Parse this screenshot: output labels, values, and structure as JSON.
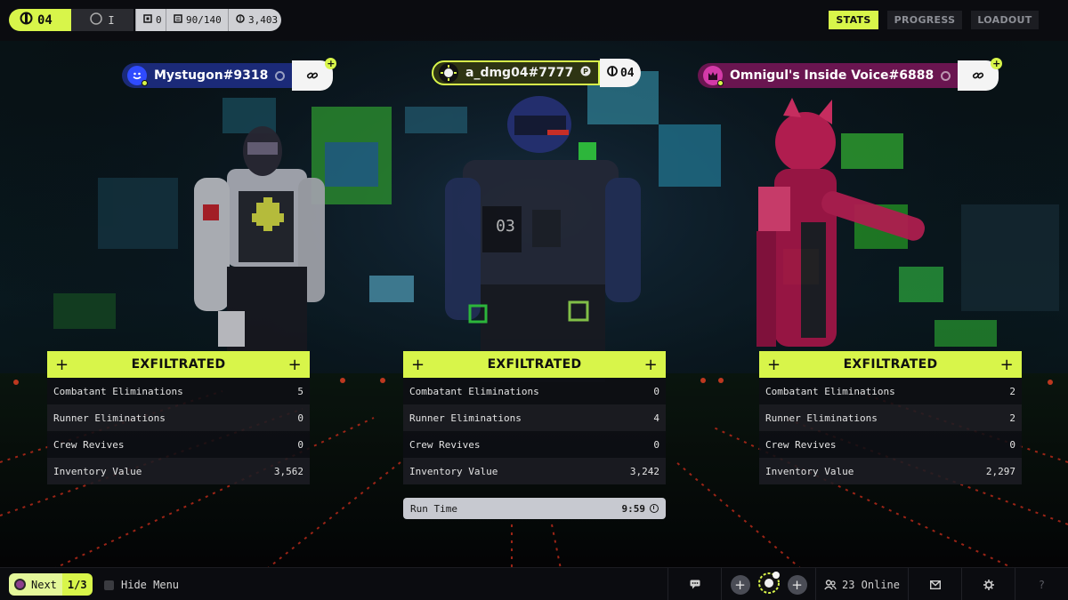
{
  "topbar": {
    "level": "04",
    "rank": "I",
    "stat_a": "0",
    "stat_b": "90/140",
    "stat_c": "3,403",
    "tabs": [
      {
        "label": "STATS",
        "active": true
      },
      {
        "label": "PROGRESS",
        "active": false
      },
      {
        "label": "LOADOUT",
        "active": false
      }
    ]
  },
  "players": [
    {
      "name": "Mystugon#9318",
      "color": "#1b2a78",
      "stats": {
        "status": "EXFILTRATED",
        "rows": [
          {
            "label": "Combatant Eliminations",
            "value": "5"
          },
          {
            "label": "Runner Eliminations",
            "value": "0"
          },
          {
            "label": "Crew Revives",
            "value": "0"
          },
          {
            "label": "Inventory Value",
            "value": "3,562"
          }
        ]
      }
    },
    {
      "name": "a_dmg04#7777",
      "level": "04",
      "color": "#d8f54a",
      "stats": {
        "status": "EXFILTRATED",
        "rows": [
          {
            "label": "Combatant Eliminations",
            "value": "0"
          },
          {
            "label": "Runner Eliminations",
            "value": "4"
          },
          {
            "label": "Crew Revives",
            "value": "0"
          },
          {
            "label": "Inventory Value",
            "value": "3,242"
          }
        ]
      },
      "run_time": {
        "label": "Run Time",
        "value": "9:59"
      }
    },
    {
      "name": "Omnigul's Inside Voice#6888",
      "color": "#6a1550",
      "stats": {
        "status": "EXFILTRATED",
        "rows": [
          {
            "label": "Combatant Eliminations",
            "value": "2"
          },
          {
            "label": "Runner Eliminations",
            "value": "2"
          },
          {
            "label": "Crew Revives",
            "value": "0"
          },
          {
            "label": "Inventory Value",
            "value": "2,297"
          }
        ]
      }
    }
  ],
  "bottombar": {
    "next_label": "Next",
    "page": "1/3",
    "hide_menu": "Hide Menu",
    "online": "23 Online",
    "help": "?"
  },
  "colors": {
    "accent": "#d8f54a",
    "panel_dark": "#0e0f14",
    "panel_light": "#1c1d23"
  }
}
